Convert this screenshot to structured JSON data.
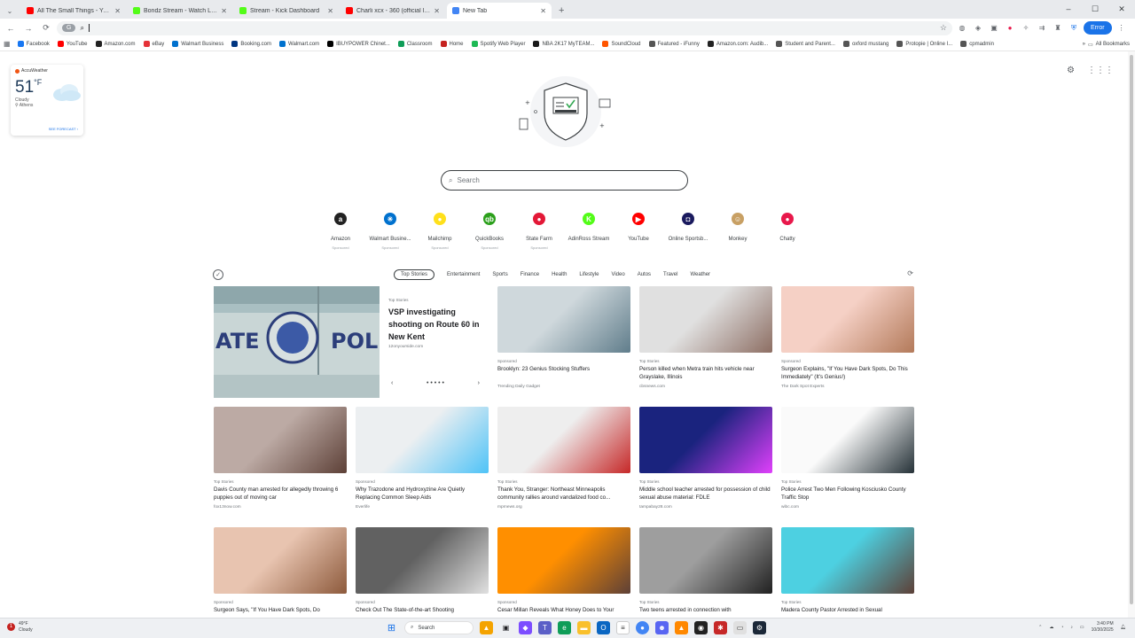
{
  "tabs": [
    {
      "title": "All The Small Things - YouTube",
      "color": "#ff0000",
      "active": false
    },
    {
      "title": "Bondz Stream - Watch Live",
      "color": "#53fc18",
      "active": false
    },
    {
      "title": "Stream - Kick Dashboard",
      "color": "#53fc18",
      "active": false
    },
    {
      "title": "Charli xcx - 360 (official lyric vi",
      "color": "#ff0000",
      "active": false
    },
    {
      "title": "New Tab",
      "color": "#4285f4",
      "active": true
    }
  ],
  "new_tab_symbol": "+",
  "window_controls": {
    "minimize": "–",
    "maximize": "☐",
    "close": "✕"
  },
  "toolbar": {
    "back": "←",
    "forward": "→",
    "reload": "⟳",
    "chip": "G",
    "omnibox_value": "",
    "error_label": "Error"
  },
  "bookmarks": [
    {
      "label": "Facebook",
      "color": "#1877f2"
    },
    {
      "label": "YouTube",
      "color": "#ff0000"
    },
    {
      "label": "Amazon.com",
      "color": "#222222"
    },
    {
      "label": "eBay",
      "color": "#e53238"
    },
    {
      "label": "Walmart Business",
      "color": "#0071ce"
    },
    {
      "label": "Booking.com",
      "color": "#003580"
    },
    {
      "label": "Walmart.com",
      "color": "#0071ce"
    },
    {
      "label": "IBUYPOWER Chinet...",
      "color": "#000000"
    },
    {
      "label": "Classroom",
      "color": "#0f9d58"
    },
    {
      "label": "Home",
      "color": "#c5221f"
    },
    {
      "label": "Spotify Web Player",
      "color": "#1db954"
    },
    {
      "label": "NBA 2K17 MyTEAM...",
      "color": "#1a1a1a"
    },
    {
      "label": "SoundCloud",
      "color": "#ff5500"
    },
    {
      "label": "Featured - iFunny",
      "color": "#555555"
    },
    {
      "label": "Amazon.com: Audib...",
      "color": "#222222"
    },
    {
      "label": "Student and Parent...",
      "color": "#555555"
    },
    {
      "label": "oxford mustang",
      "color": "#555555"
    },
    {
      "label": "Protopie | Online I...",
      "color": "#555555"
    },
    {
      "label": "cpmadmin",
      "color": "#555555"
    }
  ],
  "all_bookmarks": "All Bookmarks",
  "weather": {
    "brand": "AccuWeather",
    "temp": "51",
    "unit": "°F",
    "condition": "Cloudy",
    "location": "Athens",
    "forecast_link": "SEE FORECAST ›"
  },
  "search": {
    "placeholder": "Search"
  },
  "sites": [
    {
      "label": "Amazon",
      "sponsored": "Sponsored",
      "color": "#222222",
      "glyph": "a"
    },
    {
      "label": "Walmart Busine...",
      "sponsored": "Sponsored",
      "color": "#0071ce",
      "glyph": "✳"
    },
    {
      "label": "Mailchimp",
      "sponsored": "Sponsored",
      "color": "#ffe01b",
      "glyph": "●"
    },
    {
      "label": "QuickBooks",
      "sponsored": "Sponsored",
      "color": "#2ca01c",
      "glyph": "qb"
    },
    {
      "label": "State Farm",
      "sponsored": "Sponsored",
      "color": "#e31837",
      "glyph": "●"
    },
    {
      "label": "AdinRoss Stream",
      "sponsored": "",
      "color": "#53fc18",
      "glyph": "K"
    },
    {
      "label": "YouTube",
      "sponsored": "",
      "color": "#ff0000",
      "glyph": "▶"
    },
    {
      "label": "Online Sportsb...",
      "sponsored": "",
      "color": "#1a1a5e",
      "glyph": "◘"
    },
    {
      "label": "Monkey",
      "sponsored": "",
      "color": "#c8a064",
      "glyph": "☺"
    },
    {
      "label": "Chatty",
      "sponsored": "",
      "color": "#e8184b",
      "glyph": "●"
    }
  ],
  "news": {
    "categories": [
      "Top Stories",
      "Entertainment",
      "Sports",
      "Finance",
      "Health",
      "Lifestyle",
      "Video",
      "Autos",
      "Travel",
      "Weather"
    ],
    "feature": {
      "tag": "Top Stories",
      "title": "VSP investigating shooting on Route 60 in New Kent",
      "source": "12onyourside.com",
      "prev": "‹",
      "next": "›",
      "dots": "• • • • •"
    },
    "row1": [
      {
        "tag": "Sponsored",
        "title": "Brooklyn: 23 Genius Stocking Stuffers",
        "source": "Trending Daily Gadget"
      },
      {
        "tag": "Top Stories",
        "title": "Person killed when Metra train hits vehicle near Grayslake, Illinois",
        "source": "cbsnews.com"
      },
      {
        "tag": "Sponsored",
        "title": "Surgeon Explains, \"If You Have Dark Spots, Do This Immediately\" (It's Genius!)",
        "source": "The Dark Spot Experts"
      }
    ],
    "row2": [
      {
        "tag": "Top Stories",
        "title": "Davis County man arrested for allegedly throwing 6 puppies out of moving car",
        "source": "fox13now.com"
      },
      {
        "tag": "Sponsored",
        "title": "Why Trazodone and Hydroxyzine Are Quietly Replacing Common Sleep Aids",
        "source": "Everlife"
      },
      {
        "tag": "Top Stories",
        "title": "Thank You, Stranger: Northeast Minneapolis community rallies around vandalized food co...",
        "source": "mprnews.org"
      },
      {
        "tag": "Top Stories",
        "title": "Middle school teacher arrested for possession of child sexual abuse material: FDLE",
        "source": "tampabay28.com"
      },
      {
        "tag": "Top Stories",
        "title": "Police Arrest Two Men Following Kosciusko County Traffic Stop",
        "source": "wibc.com"
      }
    ],
    "row3": [
      {
        "tag": "Sponsored",
        "title": "Surgeon Says, \"If You Have Dark Spots, Do",
        "source": ""
      },
      {
        "tag": "Sponsored",
        "title": "Check Out The State-of-the-art Shooting",
        "source": ""
      },
      {
        "tag": "Sponsored",
        "title": "Cesar Millan Reveals What Honey Does to Your",
        "source": ""
      },
      {
        "tag": "Top Stories",
        "title": "Two teens arrested in connection with",
        "source": ""
      },
      {
        "tag": "Top Stories",
        "title": "Madera County Pastor Arrested in Sexual",
        "source": ""
      }
    ]
  },
  "taskbar": {
    "weather_temp": "49°F",
    "weather_cond": "Cloudy",
    "search_label": "Search",
    "time": "3:40 PM",
    "date": "10/30/2025"
  }
}
